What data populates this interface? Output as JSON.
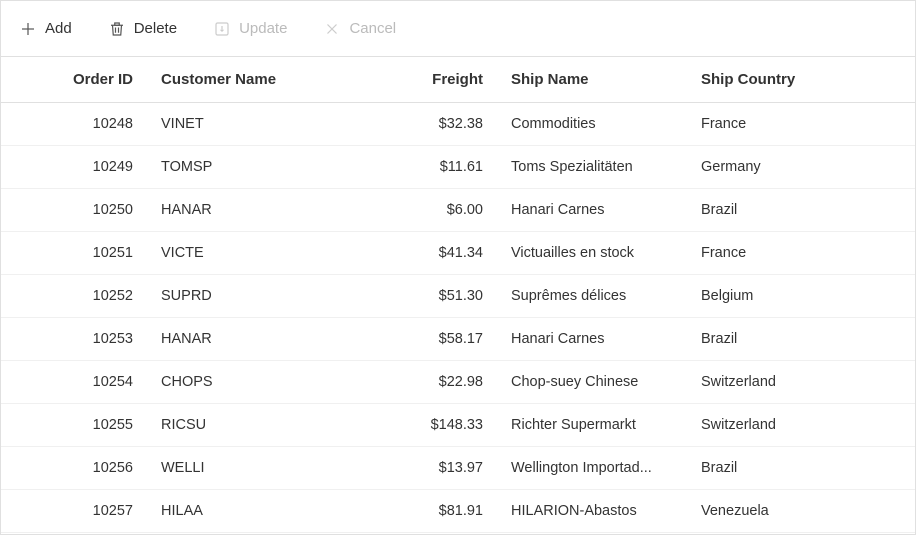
{
  "toolbar": {
    "add_label": "Add",
    "delete_label": "Delete",
    "update_label": "Update",
    "cancel_label": "Cancel"
  },
  "columns": {
    "order_id": "Order ID",
    "customer": "Customer Name",
    "freight": "Freight",
    "ship_name": "Ship Name",
    "ship_country": "Ship Country"
  },
  "rows": [
    {
      "order_id": "10248",
      "customer": "VINET",
      "freight": "$32.38",
      "ship_name": "Commodities",
      "ship_country": "France"
    },
    {
      "order_id": "10249",
      "customer": "TOMSP",
      "freight": "$11.61",
      "ship_name": "Toms Spezialitäten",
      "ship_country": "Germany"
    },
    {
      "order_id": "10250",
      "customer": "HANAR",
      "freight": "$6.00",
      "ship_name": "Hanari Carnes",
      "ship_country": "Brazil"
    },
    {
      "order_id": "10251",
      "customer": "VICTE",
      "freight": "$41.34",
      "ship_name": "Victuailles en stock",
      "ship_country": "France"
    },
    {
      "order_id": "10252",
      "customer": "SUPRD",
      "freight": "$51.30",
      "ship_name": "Suprêmes délices",
      "ship_country": "Belgium"
    },
    {
      "order_id": "10253",
      "customer": "HANAR",
      "freight": "$58.17",
      "ship_name": "Hanari Carnes",
      "ship_country": "Brazil"
    },
    {
      "order_id": "10254",
      "customer": "CHOPS",
      "freight": "$22.98",
      "ship_name": "Chop-suey Chinese",
      "ship_country": "Switzerland"
    },
    {
      "order_id": "10255",
      "customer": "RICSU",
      "freight": "$148.33",
      "ship_name": "Richter Supermarkt",
      "ship_country": "Switzerland"
    },
    {
      "order_id": "10256",
      "customer": "WELLI",
      "freight": "$13.97",
      "ship_name": "Wellington Importad...",
      "ship_country": "Brazil"
    },
    {
      "order_id": "10257",
      "customer": "HILAA",
      "freight": "$81.91",
      "ship_name": "HILARION-Abastos",
      "ship_country": "Venezuela"
    }
  ]
}
